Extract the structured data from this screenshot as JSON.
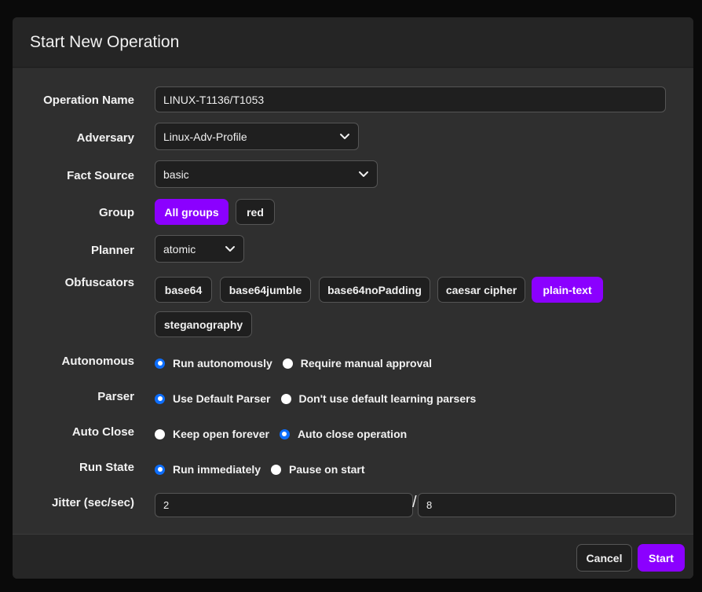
{
  "dialog": {
    "title": "Start New Operation"
  },
  "fields": {
    "operation_name": {
      "label": "Operation Name",
      "value": "LINUX-T1136/T1053"
    },
    "adversary": {
      "label": "Adversary",
      "value": "Linux-Adv-Profile",
      "icon": "chevron-down-icon"
    },
    "fact_source": {
      "label": "Fact Source",
      "value": "basic",
      "icon": "chevron-down-icon"
    },
    "group": {
      "label": "Group",
      "options": [
        "All groups",
        "red"
      ],
      "selected": "All groups"
    },
    "planner": {
      "label": "Planner",
      "value": "atomic",
      "icon": "chevron-down-icon"
    },
    "obfuscators": {
      "label": "Obfuscators",
      "options": [
        "base64",
        "base64jumble",
        "base64noPadding",
        "caesar cipher",
        "plain-text",
        "steganography"
      ],
      "selected": "plain-text"
    },
    "autonomous": {
      "label": "Autonomous",
      "options": [
        "Run autonomously",
        "Require manual approval"
      ],
      "selected": "Run autonomously"
    },
    "parser": {
      "label": "Parser",
      "options": [
        "Use Default Parser",
        "Don't use default learning parsers"
      ],
      "selected": "Use Default Parser"
    },
    "auto_close": {
      "label": "Auto Close",
      "options": [
        "Keep open forever",
        "Auto close operation"
      ],
      "selected": "Auto close operation"
    },
    "run_state": {
      "label": "Run State",
      "options": [
        "Run immediately",
        "Pause on start"
      ],
      "selected": "Run immediately"
    },
    "jitter": {
      "label": "Jitter (sec/sec)",
      "min": "2",
      "max": "8",
      "separator": "/"
    }
  },
  "footer": {
    "cancel_label": "Cancel",
    "start_label": "Start"
  },
  "colors": {
    "accent": "#8b00ff",
    "radio_checked": "#0d6efd",
    "background": "#2f2f2f"
  }
}
